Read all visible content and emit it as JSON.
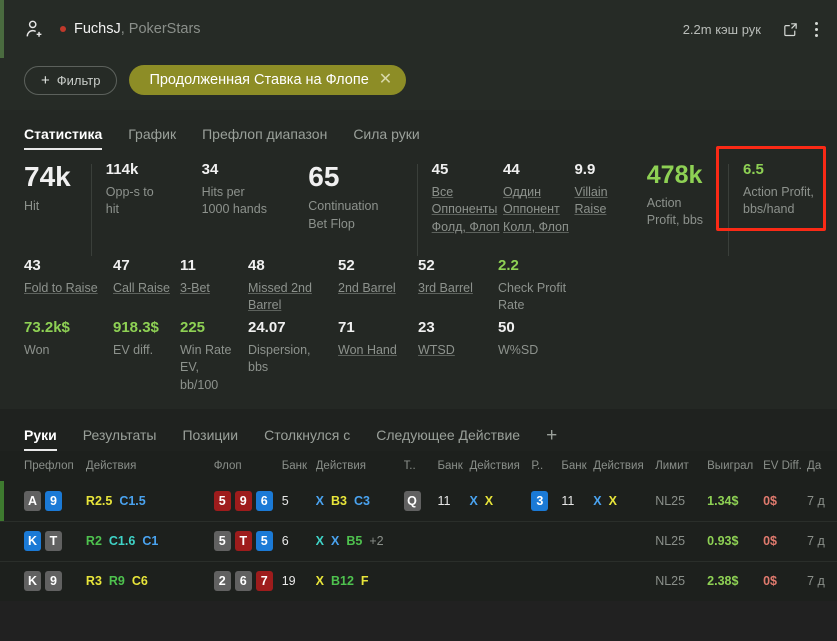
{
  "header": {
    "player_name": "FuchsJ",
    "player_site": ", PokerStars",
    "hands_count": "2.2m кэш рук",
    "filter_button": "Фильтр",
    "filter_plus": "+",
    "active_chip": "Продолженная Ставка на Флопе",
    "chip_close": "✕"
  },
  "tabs": [
    {
      "label": "Статистика",
      "active": true
    },
    {
      "label": "График",
      "active": false
    },
    {
      "label": "Префлоп диапазон",
      "active": false
    },
    {
      "label": "Сила руки",
      "active": false
    }
  ],
  "stats": {
    "row1": [
      {
        "value": "74k",
        "label": "Hit",
        "size": "big",
        "color": "white",
        "link": false
      },
      {
        "value": "114k",
        "label": "Opp-s to\nhit",
        "size": "mid",
        "color": "white",
        "link": false
      },
      {
        "value": "34",
        "label": "Hits per\n1000 hands",
        "size": "mid",
        "color": "white",
        "link": false
      },
      {
        "value": "65",
        "label": "Continuation\nBet Flop",
        "size": "big",
        "color": "white",
        "link": false
      },
      {
        "value": "45",
        "label": "Все\nОппоненты\nФолд, Флоп",
        "size": "mid",
        "color": "white",
        "link": true
      },
      {
        "value": "44",
        "label": "Оддин\nОппонент\nКолл, Флоп",
        "size": "mid",
        "color": "white",
        "link": true
      },
      {
        "value": "9.9",
        "label": "Villain\nRaise",
        "size": "mid",
        "color": "white",
        "link": true
      },
      {
        "value": "478k",
        "label": "Action\nProfit, bbs",
        "size": "biggreen",
        "color": "green",
        "link": false
      },
      {
        "value": "6.5",
        "label": "Action Profit,\nbbs/hand",
        "size": "mid",
        "color": "green",
        "link": false
      }
    ],
    "row2": [
      {
        "value": "43",
        "label": "Fold to Raise",
        "link": true,
        "color": "white"
      },
      {
        "value": "47",
        "label": "Call Raise",
        "link": true,
        "color": "white"
      },
      {
        "value": "11",
        "label": "3-Bet",
        "link": true,
        "color": "white"
      },
      {
        "value": "48",
        "label": "Missed 2nd\nBarrel",
        "link": true,
        "color": "white"
      },
      {
        "value": "52",
        "label": "2nd Barrel",
        "link": true,
        "color": "white"
      },
      {
        "value": "52",
        "label": "3rd Barrel",
        "link": true,
        "color": "white"
      },
      {
        "value": "2.2",
        "label": "Check Profit\nRate",
        "link": false,
        "color": "green"
      }
    ],
    "row3": [
      {
        "value": "73.2k$",
        "label": "Won",
        "link": false,
        "color": "green"
      },
      {
        "value": "918.3$",
        "label": "EV diff.",
        "link": false,
        "color": "green"
      },
      {
        "value": "225",
        "label": "Win Rate EV,\nbb/100",
        "link": false,
        "color": "green"
      },
      {
        "value": "24.07",
        "label": "Dispersion,\nbbs",
        "link": false,
        "color": "white"
      },
      {
        "value": "71",
        "label": "Won Hand",
        "link": true,
        "color": "white"
      },
      {
        "value": "23",
        "label": "WTSD",
        "link": true,
        "color": "white"
      },
      {
        "value": "50",
        "label": "W%SD",
        "link": false,
        "color": "white"
      }
    ]
  },
  "lower_tabs": [
    {
      "label": "Руки",
      "active": true
    },
    {
      "label": "Результаты",
      "active": false
    },
    {
      "label": "Позиции",
      "active": false
    },
    {
      "label": "Столкнулся с",
      "active": false
    },
    {
      "label": "Следующее Действие",
      "active": false
    }
  ],
  "add_tab": "+",
  "table": {
    "headers": [
      "Префлоп",
      "Действия",
      "Флоп",
      "Банк",
      "Действия",
      "Т..",
      "Банк",
      "Действия",
      "Р..",
      "Банк",
      "Действия",
      "Лимит",
      "Выиграл",
      "EV Diff.",
      "Да"
    ],
    "rows": [
      {
        "edge_color": "#3e7a2f",
        "preflop_cards": [
          {
            "text": "A",
            "style": "gray"
          },
          {
            "text": "9",
            "style": "blue"
          }
        ],
        "preflop_actions": [
          {
            "text": "R2.5",
            "color": "yellow",
            "underline": "y"
          },
          {
            "text": "C1.5",
            "color": "blue",
            "underline": "none"
          }
        ],
        "flop_cards": [
          {
            "text": "5",
            "style": "red"
          },
          {
            "text": "9",
            "style": "red"
          },
          {
            "text": "6",
            "style": "blue"
          }
        ],
        "flop_pot": "5",
        "flop_actions": [
          {
            "text": "X",
            "color": "blue",
            "underline": "none"
          },
          {
            "text": "B3",
            "color": "yellow",
            "underline": "y"
          },
          {
            "text": "C3",
            "color": "blue",
            "underline": "none"
          }
        ],
        "turn_card": {
          "text": "Q",
          "style": "gray"
        },
        "turn_pot": "11",
        "turn_actions": [
          {
            "text": "X",
            "color": "blue",
            "underline": "none"
          },
          {
            "text": "X",
            "color": "yellow",
            "underline": "y"
          }
        ],
        "river_card": {
          "text": "3",
          "style": "blue"
        },
        "river_pot": "11",
        "river_actions": [
          {
            "text": "X",
            "color": "blue",
            "underline": "none"
          },
          {
            "text": "X",
            "color": "yellow",
            "underline": "y"
          }
        ],
        "limit": "NL25",
        "won": "1.34$",
        "ev_diff": "0$",
        "date": "7 д"
      },
      {
        "edge_color": "",
        "preflop_cards": [
          {
            "text": "K",
            "style": "blue"
          },
          {
            "text": "T",
            "style": "gray"
          }
        ],
        "preflop_actions": [
          {
            "text": "R2",
            "color": "green",
            "underline": "g"
          },
          {
            "text": "C1.6",
            "color": "cyan",
            "underline": "none"
          },
          {
            "text": "C1",
            "color": "blue",
            "underline": "none"
          }
        ],
        "flop_cards": [
          {
            "text": "5",
            "style": "gray"
          },
          {
            "text": "T",
            "style": "red"
          },
          {
            "text": "5",
            "style": "blue"
          }
        ],
        "flop_pot": "6",
        "flop_actions": [
          {
            "text": "X",
            "color": "cyan",
            "underline": "none"
          },
          {
            "text": "X",
            "color": "blue",
            "underline": "none"
          },
          {
            "text": "B5",
            "color": "green",
            "underline": "g"
          },
          {
            "text": "+2",
            "color": "gray",
            "underline": "gray"
          }
        ],
        "turn_card": null,
        "turn_pot": "",
        "turn_actions": [],
        "river_card": null,
        "river_pot": "",
        "river_actions": [],
        "limit": "NL25",
        "won": "0.93$",
        "ev_diff": "0$",
        "date": "7 д"
      },
      {
        "edge_color": "",
        "preflop_cards": [
          {
            "text": "K",
            "style": "gray"
          },
          {
            "text": "9",
            "style": "gray"
          }
        ],
        "preflop_actions": [
          {
            "text": "R3",
            "color": "yellow",
            "underline": "none"
          },
          {
            "text": "R9",
            "color": "green",
            "underline": "g"
          },
          {
            "text": "C6",
            "color": "yellow",
            "underline": "none"
          }
        ],
        "flop_cards": [
          {
            "text": "2",
            "style": "gray"
          },
          {
            "text": "6",
            "style": "gray"
          },
          {
            "text": "7",
            "style": "red"
          }
        ],
        "flop_pot": "19",
        "flop_actions": [
          {
            "text": "X",
            "color": "yellow",
            "underline": "none"
          },
          {
            "text": "B12",
            "color": "green",
            "underline": "g"
          },
          {
            "text": "F",
            "color": "yellow",
            "underline": "none"
          }
        ],
        "turn_card": null,
        "turn_pot": "",
        "turn_actions": [],
        "river_card": null,
        "river_pot": "",
        "river_actions": [],
        "limit": "NL25",
        "won": "2.38$",
        "ev_diff": "0$",
        "date": "7 д"
      }
    ]
  },
  "colors": {
    "accent_green": "#8ed154",
    "chip_olive": "#8d8d26",
    "highlight_red": "#fa2a16"
  }
}
